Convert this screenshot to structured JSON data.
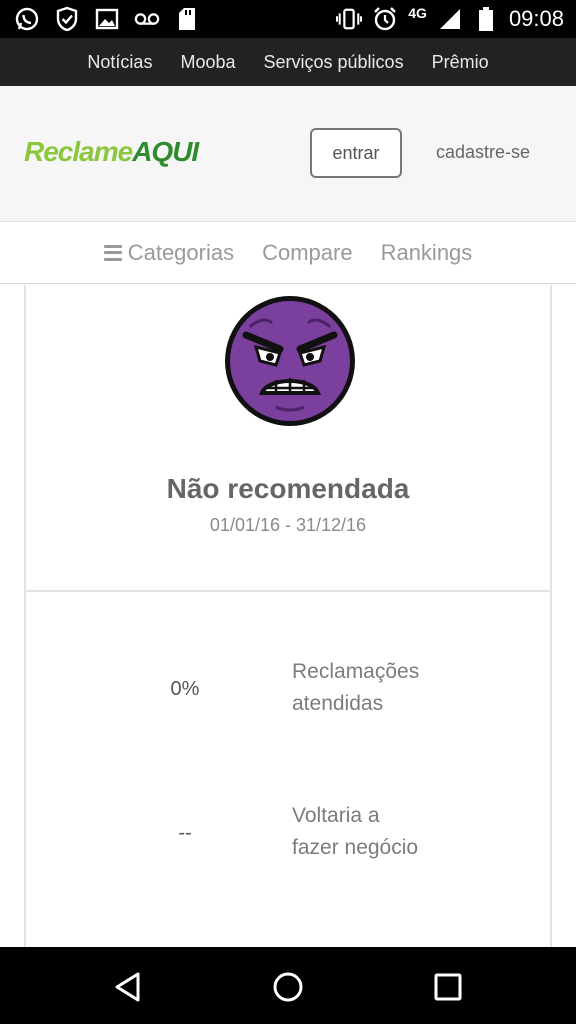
{
  "status_bar": {
    "time": "09:08",
    "network": "4G",
    "icons": [
      "whatsapp-icon",
      "shield-check-icon",
      "image-icon",
      "voicemail-icon",
      "sd-card-icon",
      "vibrate-icon",
      "alarm-icon",
      "signal-icon",
      "battery-icon"
    ]
  },
  "top_nav": {
    "items": [
      "Notícias",
      "Mooba",
      "Serviços públicos",
      "Prêmio"
    ]
  },
  "header": {
    "logo_part1": "Reclame",
    "logo_part2": "AQUI",
    "login_label": "entrar",
    "signup_label": "cadastre-se"
  },
  "sub_nav": {
    "categories_label": "Categorias",
    "compare_label": "Compare",
    "rankings_label": "Rankings"
  },
  "reputation": {
    "status": "Não recomendada",
    "period": "01/01/16 - 31/12/16",
    "face_color": "#7b3f9e"
  },
  "metrics": [
    {
      "value": "0%",
      "label_line1": "Reclamações",
      "label_line2": "atendidas"
    },
    {
      "value": "--",
      "label_line1": "Voltaria a",
      "label_line2": "fazer negócio"
    }
  ],
  "nav_bar": {
    "buttons": [
      "back-icon",
      "home-icon",
      "recents-icon"
    ]
  }
}
